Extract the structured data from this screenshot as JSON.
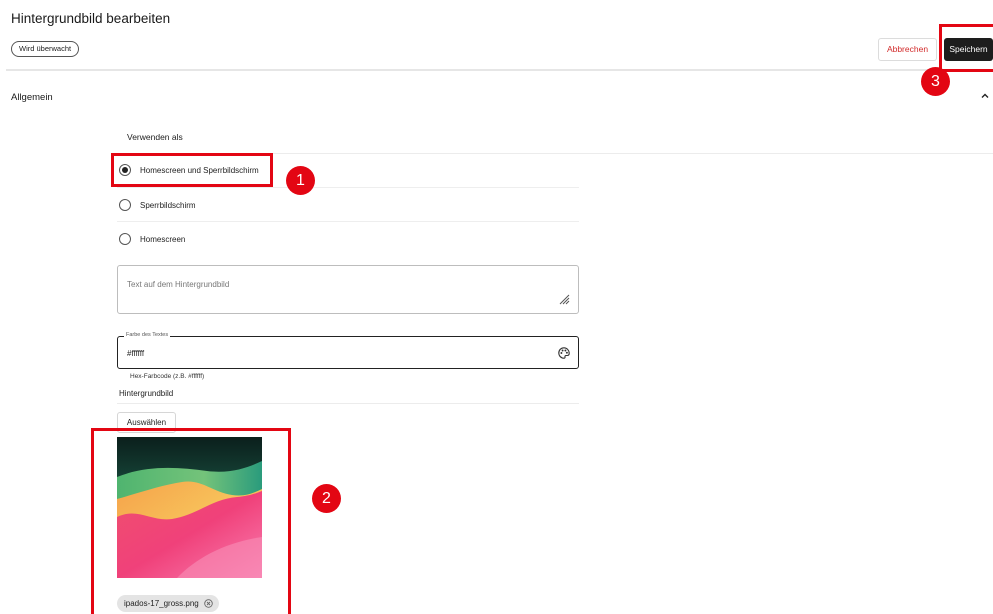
{
  "header": {
    "title": "Hintergrundbild bearbeiten",
    "status_badge": "Wird überwacht",
    "cancel_label": "Abbrechen",
    "save_label": "Speichern"
  },
  "section": {
    "title": "Allgemein",
    "collapse_icon": "chevron-up-icon"
  },
  "usage": {
    "label": "Verwenden als",
    "selected_index": 0,
    "options": [
      {
        "label": "Homescreen und Sperrbildschirm",
        "checked": true
      },
      {
        "label": "Sperrbildschirm",
        "checked": false
      },
      {
        "label": "Homescreen",
        "checked": false
      }
    ]
  },
  "text_field": {
    "placeholder": "Text auf dem Hintergrundbild",
    "value": "",
    "resize_icon": "resize-handle-icon"
  },
  "color_field": {
    "label": "Farbe des Textes",
    "value": "#ffffff",
    "helper": "Hex-Farbcode (z.B. #ffffff)",
    "icon": "palette-icon"
  },
  "background": {
    "label": "Hintergrundbild",
    "choose_label": "Auswählen",
    "file_name": "ipados-17_gross.png",
    "remove_icon": "close-circle-icon"
  },
  "annotations": {
    "color": "#e30613",
    "badges": [
      "1",
      "2",
      "3"
    ]
  },
  "colors": {
    "save_button": "#1d1d1d",
    "cancel_text": "#d22b2b",
    "annotation": "#e30613"
  }
}
